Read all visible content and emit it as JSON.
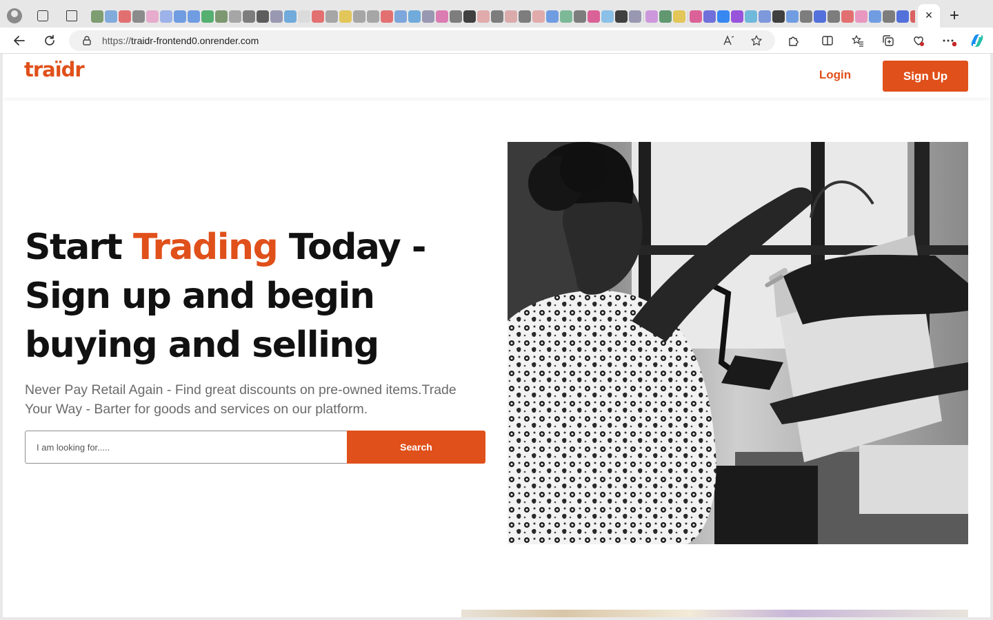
{
  "browser": {
    "url_protocol": "https://",
    "url_host": "traidr-frontend0.onrender.com",
    "tab_close_glyph": "×",
    "new_tab_glyph": "+",
    "favicon_colors": [
      "#6b8f5a",
      "#6fa0d8",
      "#e25b5b",
      "#7a7a7a",
      "#e6a0c8",
      "#8fa8e8",
      "#5b8fe0",
      "#5b8fe0",
      "#3ba55c",
      "#6a8a5a",
      "#9a9a9a",
      "#6a6a6a",
      "#444444",
      "#8a8aa8",
      "#5ba0d8",
      "#d8d8d8",
      "#e25b5b",
      "#9a9a9a",
      "#e0c040",
      "#9a9a9a",
      "#9a9a9a",
      "#e25b5b",
      "#6a9ad8",
      "#5ba0d8",
      "#8a8aa8",
      "#d86aa8",
      "#6a6a6a",
      "#222222",
      "#e0a0a0",
      "#6a6a6a",
      "#d8a0a0",
      "#6a6a6a",
      "#e0a0a0",
      "#5b8fe0",
      "#6ab088",
      "#6a6a6a",
      "#d84a8a",
      "#7ab8e8",
      "#222222",
      "#8a8aa8",
      "#c88ad8",
      "#4a8a5a",
      "#e0c040",
      "#d84a8a",
      "#5b5bd8",
      "#1877f2",
      "#8a3ad8",
      "#5bb0d8",
      "#6a8ad8",
      "#222222",
      "#5b8fe0",
      "#6a6a6a",
      "#3a5ad8",
      "#6a6a6a",
      "#e25b5b",
      "#e88ab8",
      "#5b8fe0",
      "#6a6a6a",
      "#3a5ad8",
      "#d84a4a",
      "#222222",
      "#3a5ad8"
    ]
  },
  "site": {
    "logo": "traïdr",
    "nav": {
      "login": "Login",
      "signup": "Sign Up"
    },
    "hero": {
      "headline_pre": "Start ",
      "headline_accent": "Trading",
      "headline_post": " Today - Sign up and begin buying and selling",
      "subtext": "Never Pay Retail Again - Find great discounts on pre-owned items.Trade Your Way - Barter for goods and services on our platform.",
      "search_placeholder": "I am looking for.....",
      "search_button": "Search"
    }
  },
  "colors": {
    "brand_orange": "#e0501a",
    "headline_text": "#111111",
    "subtext": "#6a6a6a"
  },
  "icons": {
    "tab_strip": [
      "profile-icon",
      "workspaces-icon",
      "tab-actions-icon",
      "close-icon",
      "plus-icon"
    ],
    "toolbar": [
      "back-arrow-icon",
      "refresh-icon",
      "lock-icon",
      "read-aloud-icon",
      "favorite-star-icon",
      "extensions-icon",
      "split-screen-icon",
      "favorites-icon",
      "collections-icon",
      "browser-essentials-icon",
      "more-options-icon",
      "copilot-icon"
    ]
  }
}
